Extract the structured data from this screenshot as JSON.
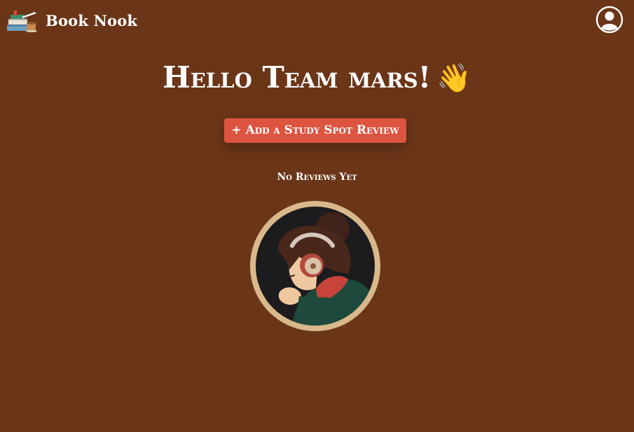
{
  "brand": {
    "name": "Book Nook",
    "logo_icon": "books-icon"
  },
  "header": {
    "profile_icon": "user-circle-icon"
  },
  "main": {
    "greeting": "Hello Team mars!",
    "greeting_emoji": "👋",
    "add_button_label": "+ Add a Study Spot Review",
    "empty_state": "No Reviews Yet",
    "illustration_icon": "lofi-girl-headphones-image"
  },
  "colors": {
    "background": "#6b3518",
    "button": "#dd5440",
    "avatar_ring": "#d9b98c",
    "text": "#ffffff"
  }
}
